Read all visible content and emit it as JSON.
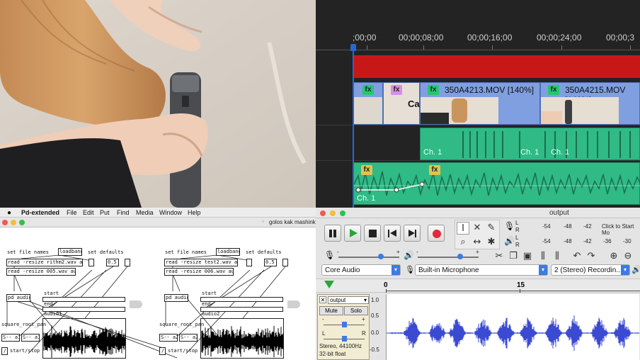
{
  "premiere": {
    "timecodes": [
      ";00;00",
      "00;00;08;00",
      "00;00;16;00",
      "00;00;24;00",
      "00;00;3"
    ],
    "clips": [
      {
        "fx": "fx",
        "name": ""
      },
      {
        "fx": "fx",
        "name": ""
      },
      {
        "fx": "fx",
        "name": "350A4213.MOV [140%]"
      },
      {
        "fx": "fx",
        "name": "350A4215.MOV [140%]"
      }
    ],
    "audio_fx": [
      "fx",
      "fx"
    ],
    "channel_labels": [
      "Ch. 1",
      "Ch. 1",
      "Ch. 1",
      "Ch. 1"
    ],
    "colors": {
      "video_clip": "#7f9fe0",
      "audio_clip": "#2fba86",
      "work_area": "#d01818",
      "playhead": "#2a66d9"
    }
  },
  "pd": {
    "menu": {
      "app": "Pd-extended",
      "items": [
        "File",
        "Edit",
        "Put",
        "Find",
        "Media",
        "Window",
        "Help"
      ]
    },
    "window_title": "golos kak mashink",
    "left": {
      "set_file_names": "set file names",
      "loadbang": "loadbang",
      "set_defaults": "set defaults",
      "read1": "read -resize rithm2.wav audio1",
      "read2": "read -resize 005.wav audio1",
      "number": "0.5",
      "subpatch": "pd audio1",
      "start": "start",
      "end": "end",
      "array": "audio1",
      "square_root": "square_root_pan",
      "s1": "S-- a11",
      "s2": "S-- a12",
      "toggle_label": "start/stop"
    },
    "right": {
      "set_file_names": "set file names",
      "loadbang": "loadbang",
      "set_defaults": "set defaults",
      "read1": "read -resize test2.wav audio2",
      "read2": "read -resize 006.wav audio2",
      "number": "0.5",
      "subpatch": "pd audio2",
      "start": "start",
      "end": "end",
      "array": "audio2",
      "square_root": "square_root_pan",
      "s1": "S-- a21",
      "s2": "S-- a22",
      "toggle_label": "start/stop"
    }
  },
  "audacity": {
    "window_title": "output",
    "meter_scale_rec": [
      "-54",
      "-48",
      "-42",
      "Click to Start Mo"
    ],
    "meter_scale_play": [
      "-54",
      "-48",
      "-42",
      "-36",
      "-30"
    ],
    "meter_channels": [
      "L",
      "R"
    ],
    "host": "Core Audio",
    "input_device": "Built-in Microphone",
    "channels": "2 (Stereo) Recordin...",
    "timeline": [
      "0",
      "15"
    ],
    "track": {
      "name": "output",
      "mute": "Mute",
      "solo": "Solo",
      "gain_labels": [
        "-",
        "+"
      ],
      "pan_labels": [
        "L",
        "R"
      ],
      "info_line1": "Stereo, 44100Hz",
      "info_line2": "32-bit float"
    },
    "amplitude_scale": [
      "1.0",
      "0.5",
      "0.0",
      "-0.5"
    ],
    "colors": {
      "waveform": "#3a4ad1",
      "track_bg": "#ffffff",
      "selection_bg": "#f2ecd2"
    }
  }
}
